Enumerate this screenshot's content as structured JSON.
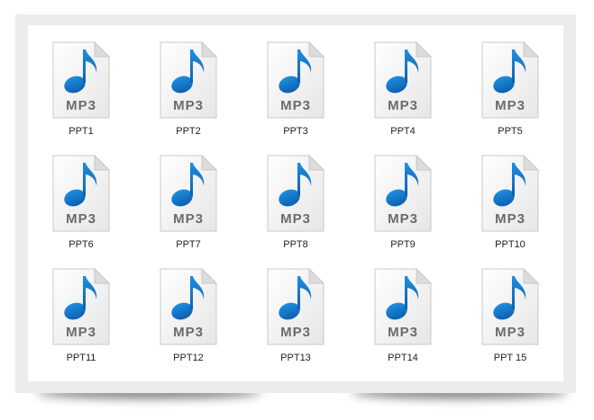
{
  "files": [
    {
      "label": "PPT1",
      "type_text": "MP3"
    },
    {
      "label": "PPT2",
      "type_text": "MP3"
    },
    {
      "label": "PPT3",
      "type_text": "MP3"
    },
    {
      "label": "PPT4",
      "type_text": "MP3"
    },
    {
      "label": "PPT5",
      "type_text": "MP3"
    },
    {
      "label": "PPT6",
      "type_text": "MP3"
    },
    {
      "label": "PPT7",
      "type_text": "MP3"
    },
    {
      "label": "PPT8",
      "type_text": "MP3"
    },
    {
      "label": "PPT9",
      "type_text": "MP3"
    },
    {
      "label": "PPT10",
      "type_text": "MP3"
    },
    {
      "label": "PPT11",
      "type_text": "MP3"
    },
    {
      "label": "PPT12",
      "type_text": "MP3"
    },
    {
      "label": "PPT13",
      "type_text": "MP3"
    },
    {
      "label": "PPT14",
      "type_text": "MP3"
    },
    {
      "label": "PPT 15",
      "type_text": "MP3"
    }
  ],
  "icon": {
    "name": "mp3-file-icon",
    "note_color": "#1e8fe0",
    "note_color_dark": "#0d5fb0",
    "text_color": "#6b6b6b"
  }
}
